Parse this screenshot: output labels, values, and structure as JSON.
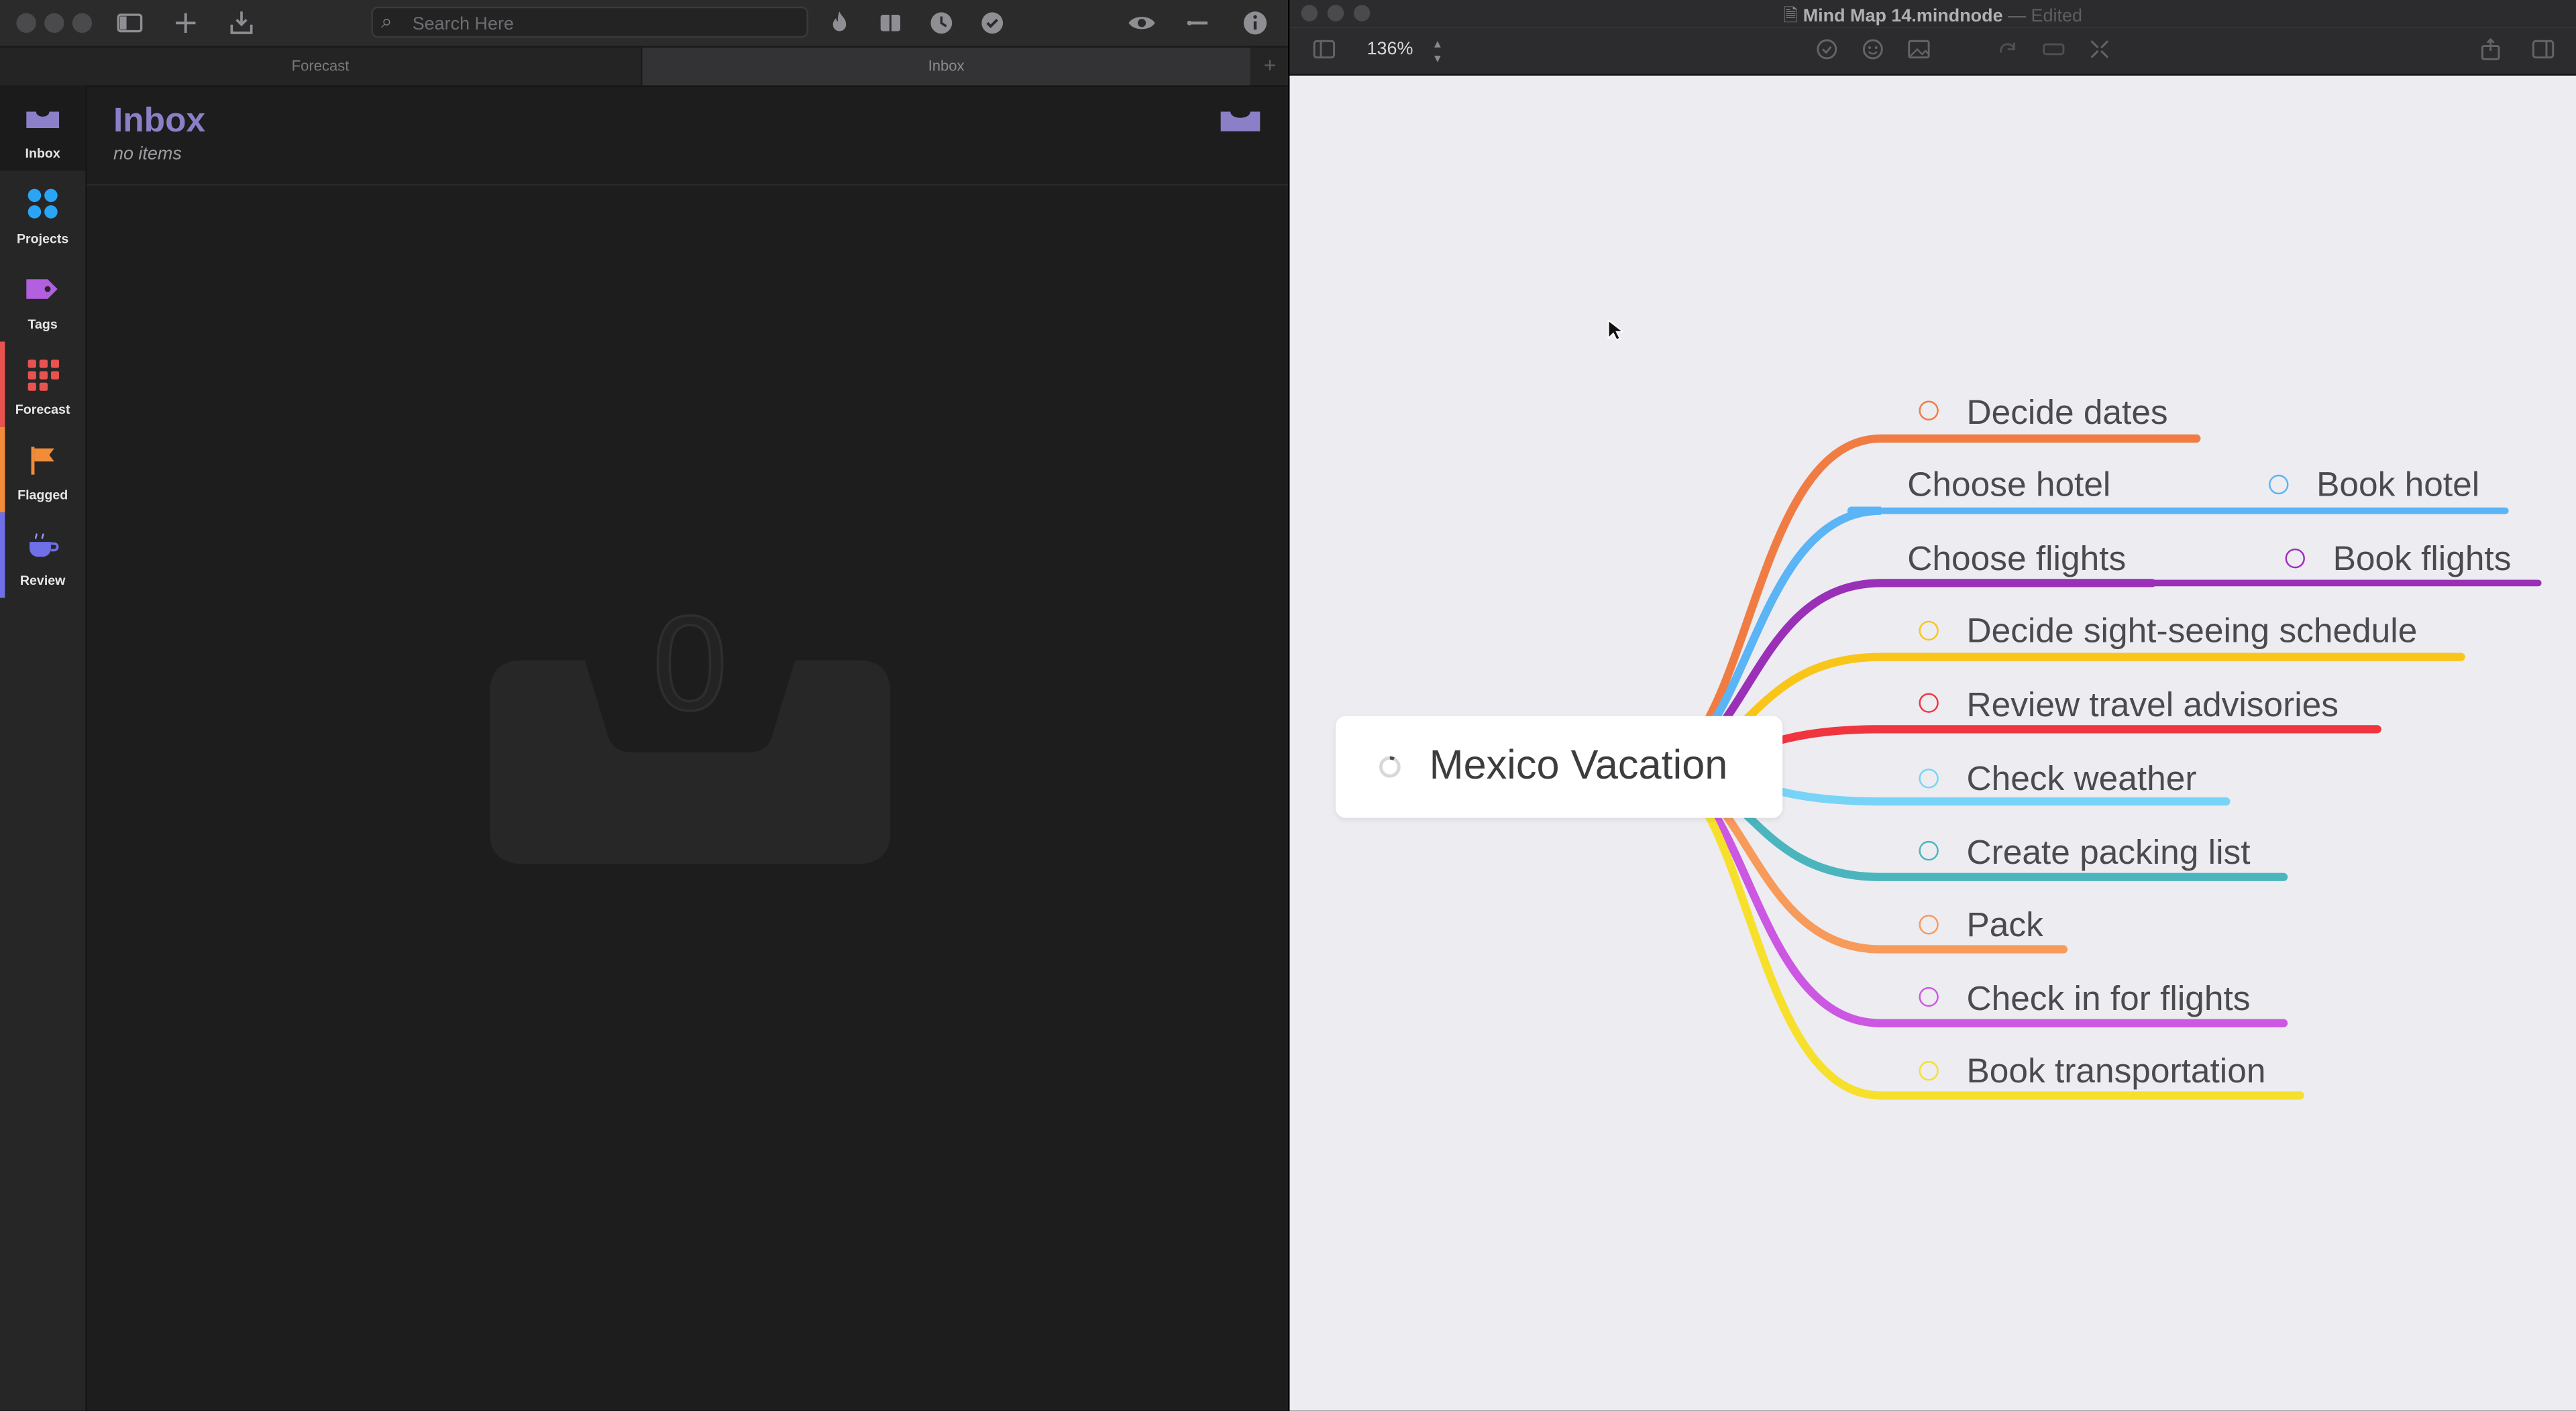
{
  "omnifocus": {
    "search": {
      "placeholder": "Search Here"
    },
    "tabs": [
      "Forecast",
      "Inbox"
    ],
    "sidebar": [
      {
        "label": "Inbox",
        "icon": "inbox-tray-icon",
        "color": "#8b7fc7"
      },
      {
        "label": "Projects",
        "icon": "projects-dots-icon",
        "color": "#2aa4f4"
      },
      {
        "label": "Tags",
        "icon": "tag-icon",
        "color": "#b25fe0"
      },
      {
        "label": "Forecast",
        "icon": "forecast-grid-icon",
        "color": "#e8524f"
      },
      {
        "label": "Flagged",
        "icon": "flag-icon",
        "color": "#f28c38"
      },
      {
        "label": "Review",
        "icon": "coffee-cup-icon",
        "color": "#6f6fe8"
      }
    ],
    "inbox": {
      "title": "Inbox",
      "subtitle": "no items",
      "empty_count": "0"
    }
  },
  "mindnode": {
    "document": "Mind Map 14.mindnode",
    "separator": "—",
    "status": "Edited",
    "zoom": "136%",
    "root": "Mexico Vacation",
    "nodes": [
      {
        "label": "Decide dates",
        "color": "#f07c43",
        "has_circle": true
      },
      {
        "label": "Choose hotel",
        "color": "#5ab4f5",
        "has_circle": false,
        "child": "Book hotel"
      },
      {
        "label": "Choose flights",
        "color": "#9b30b8",
        "has_circle": false,
        "child": "Book flights"
      },
      {
        "label": "Decide sight-seeing schedule",
        "color": "#f9c519",
        "has_circle": true
      },
      {
        "label": "Review travel advisories",
        "color": "#f0353f",
        "has_circle": true
      },
      {
        "label": "Check weather",
        "color": "#78d4f7",
        "has_circle": true
      },
      {
        "label": "Create packing list",
        "color": "#4bb5bd",
        "has_circle": true
      },
      {
        "label": "Pack",
        "color": "#f79a5a",
        "has_circle": true
      },
      {
        "label": "Check in for flights",
        "color": "#cc57e3",
        "has_circle": true
      },
      {
        "label": "Book transportation",
        "color": "#f6e02c",
        "has_circle": true
      }
    ]
  }
}
